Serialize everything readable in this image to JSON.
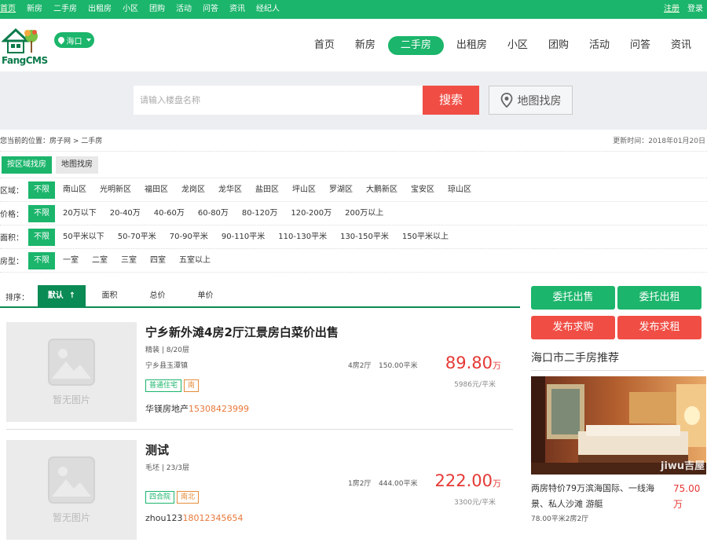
{
  "topbar": {
    "links": [
      "首页",
      "新房",
      "二手房",
      "出租房",
      "小区",
      "团购",
      "活动",
      "问答",
      "资讯",
      "经纪人"
    ],
    "register": "注册",
    "login": "登录"
  },
  "header": {
    "logo_text": "FangCMS",
    "city": "海口",
    "nav": [
      "首页",
      "新房",
      "二手房",
      "出租房",
      "小区",
      "团购",
      "活动",
      "问答",
      "资讯"
    ],
    "active_nav": "二手房"
  },
  "search": {
    "placeholder": "请输入楼盘名称",
    "button": "搜索",
    "map_button": "地图找房"
  },
  "breadcrumb": {
    "text": "您当前的位置：房子网 > 二手房",
    "updated": "更新时间：2018年01月20日"
  },
  "mode_tabs": [
    "按区域找房",
    "地图找房"
  ],
  "filters": [
    {
      "label": "区域：",
      "options": [
        "不限",
        "南山区",
        "光明新区",
        "福田区",
        "龙岗区",
        "龙华区",
        "盐田区",
        "坪山区",
        "罗湖区",
        "大鹏新区",
        "宝安区",
        "琼山区"
      ]
    },
    {
      "label": "价格：",
      "options": [
        "不限",
        "20万以下",
        "20-40万",
        "40-60万",
        "60-80万",
        "80-120万",
        "120-200万",
        "200万以上"
      ]
    },
    {
      "label": "面积：",
      "options": [
        "不限",
        "50平米以下",
        "50-70平米",
        "70-90平米",
        "90-110平米",
        "110-130平米",
        "130-150平米",
        "150平米以上"
      ]
    },
    {
      "label": "房型：",
      "options": [
        "不限",
        "一室",
        "二室",
        "三室",
        "四室",
        "五室以上"
      ]
    }
  ],
  "sort": {
    "label": "排序：",
    "items": [
      "默认",
      "面积",
      "总价",
      "单价"
    ],
    "arrow": "↑"
  },
  "no_image_text": "暂无图片",
  "listings": [
    {
      "title": "宁乡新外滩4房2厅江景房白菜价出售",
      "meta": "精装 | 8/20层",
      "address": "宁乡县玉潭镇",
      "rooms": "4房2厅",
      "area": "150.00平米",
      "tags": [
        {
          "text": "普通住宅",
          "color": "#1bb56b"
        },
        {
          "text": "南",
          "color": "#e58c3a"
        }
      ],
      "agent": "华镁房地产",
      "phone": "15308423999",
      "price": "89.80",
      "price_unit": "万",
      "unit_price": "5986元/平米"
    },
    {
      "title": "测试",
      "meta": "毛坯 | 23/3层",
      "address": "",
      "rooms": "1房2厅",
      "area": "444.00平米",
      "tags": [
        {
          "text": "四合院",
          "color": "#1bb56b"
        },
        {
          "text": "南北",
          "color": "#e58c3a"
        }
      ],
      "agent": "zhou123",
      "phone": "18012345654",
      "price": "222.00",
      "price_unit": "万",
      "unit_price": "3300元/平米"
    }
  ],
  "sidebar": {
    "buttons": [
      "委托出售",
      "委托出租",
      "发布求购",
      "发布求租"
    ],
    "title": "海口市二手房推荐",
    "rec_name": "两房特价79万滨海国际、一线海景、私人沙滩 游艇",
    "rec_price": "75.00万",
    "rec_sub": "78.00平米2房2厅",
    "photo_watermark": "jiwu吉屋"
  },
  "colors": {
    "brand_green": "#1bb56b",
    "dark_green": "#0a8a54",
    "red": "#f04e45",
    "price_red": "#e53935",
    "phone_orange": "#e8783a"
  }
}
